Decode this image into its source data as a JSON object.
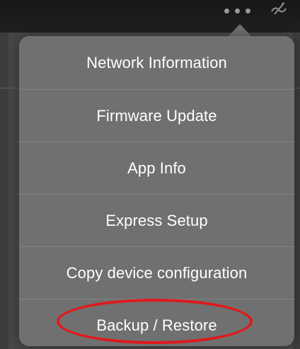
{
  "top_bar": {
    "more_button_icon": "more-dots-icon",
    "status_icon": "signal-off-icon"
  },
  "menu": {
    "items": [
      {
        "label": "Network Information"
      },
      {
        "label": "Firmware Update"
      },
      {
        "label": "App Info"
      },
      {
        "label": "Express Setup"
      },
      {
        "label": "Copy device configuration"
      },
      {
        "label": "Backup / Restore"
      }
    ]
  },
  "colors": {
    "popover_bg": "#707070",
    "highlight_ring": "#e0191b",
    "text": "#ffffff"
  }
}
